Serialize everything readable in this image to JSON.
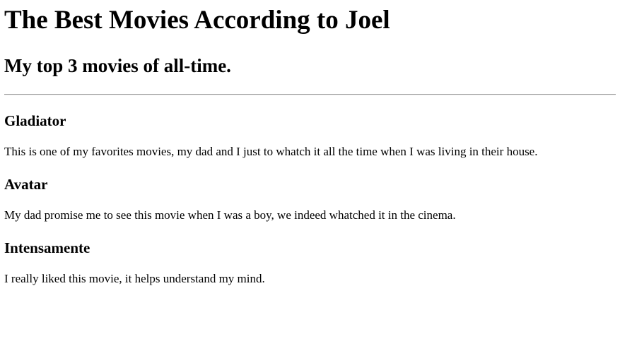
{
  "header": {
    "title": "The Best Movies According to Joel",
    "subtitle": "My top 3 movies of all-time."
  },
  "movies": [
    {
      "title": "Gladiator",
      "description": "This is one of my favorites movies, my dad and I just to whatch it all the time when I was living in their house."
    },
    {
      "title": "Avatar",
      "description": "My dad promise me to see this movie when I was a boy, we indeed whatched it in the cinema."
    },
    {
      "title": "Intensamente",
      "description": "I really liked this movie, it helps understand my mind."
    }
  ]
}
